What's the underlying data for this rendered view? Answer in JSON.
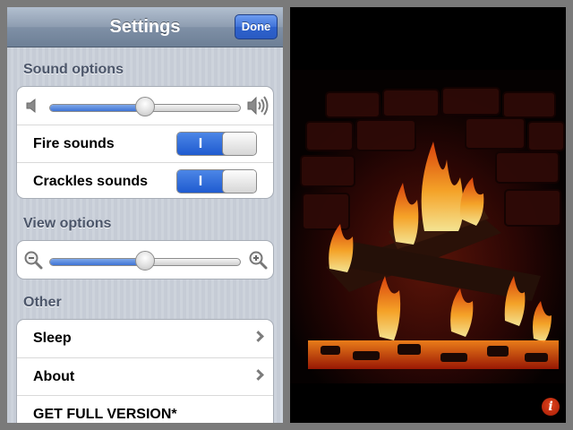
{
  "settings": {
    "title": "Settings",
    "done_label": "Done"
  },
  "sound_options": {
    "header": "Sound options",
    "volume_level": 0.5,
    "fire_sounds": {
      "label": "Fire sounds",
      "on": true,
      "on_text": "I"
    },
    "crackles_sounds": {
      "label": "Crackles sounds",
      "on": true,
      "on_text": "I"
    }
  },
  "view_options": {
    "header": "View options",
    "zoom_level": 0.5
  },
  "other": {
    "header": "Other",
    "items": [
      {
        "label": "Sleep",
        "chevron": true
      },
      {
        "label": "About",
        "chevron": true
      },
      {
        "label": "GET FULL VERSION*",
        "chevron": false
      }
    ]
  },
  "fireplace": {
    "info_glyph": "i"
  },
  "icons": {
    "volume_low": "speaker-low-icon",
    "volume_high": "speaker-high-icon",
    "zoom_out": "zoom-out-icon",
    "zoom_in": "zoom-in-icon",
    "chevron": "chevron-right-icon",
    "info": "info-icon"
  },
  "colors": {
    "accent_blue": "#2f66d0",
    "navbar": "#8d9cb0",
    "section_text": "#4c566a",
    "info_red": "#c52a0c"
  }
}
